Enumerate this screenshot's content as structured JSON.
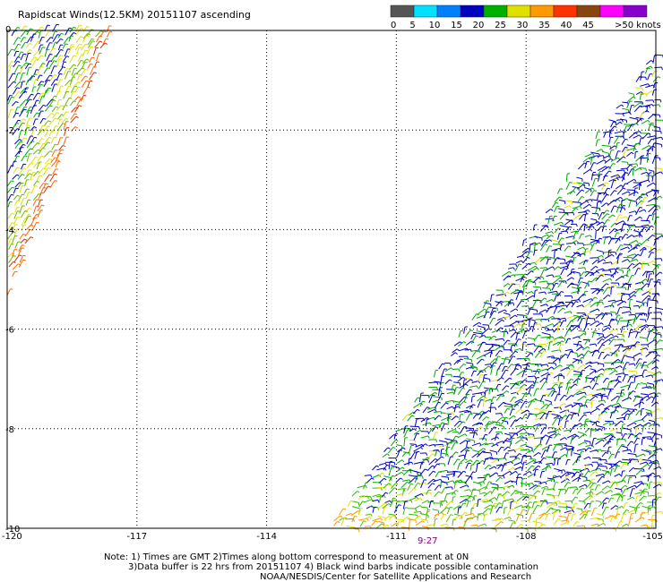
{
  "title": "Rapidscat Winds(12.5KM) 20151107 ascending",
  "legend": {
    "labels": [
      "0",
      "5",
      "10",
      "15",
      "20",
      "25",
      "30",
      "35",
      "40",
      "45",
      ">50 knots"
    ],
    "colors": [
      "#555555",
      "#00e0ff",
      "#0080ff",
      "#0000c0",
      "#00b000",
      "#e0e000",
      "#ff9900",
      "#ff3300",
      "#884411",
      "#ff00ff",
      "#8800cc"
    ]
  },
  "axes": {
    "x_ticks": [
      "-120",
      "-117",
      "-114",
      "-111",
      "-108",
      "-105"
    ],
    "y_ticks": [
      "0",
      "-2",
      "-4",
      "-6",
      "-8",
      "-10"
    ],
    "lon_range": [
      -120,
      -105
    ],
    "lat_range": [
      -10,
      0
    ],
    "grid": "dotted"
  },
  "time_label": "9:27",
  "notes": {
    "line1": "Note: 1) Times are GMT 2)Times along bottom correspond to measurement at 0N",
    "line2": "3)Data buffer is 22 hrs from 20151107 4) Black wind barbs indicate possible contamination",
    "line3": "NOAA/NESDIS/Center for Satellite Applications and Research"
  },
  "swaths": [
    {
      "name": "west-swath",
      "corners_lonlat": [
        [
          -120,
          0
        ],
        [
          -117.6,
          0
        ],
        [
          -120,
          -5.4
        ]
      ]
    },
    {
      "name": "east-swath",
      "corners_lonlat": [
        [
          -105,
          -0.4
        ],
        [
          -105,
          -10
        ],
        [
          -112.6,
          -10
        ]
      ]
    }
  ]
}
